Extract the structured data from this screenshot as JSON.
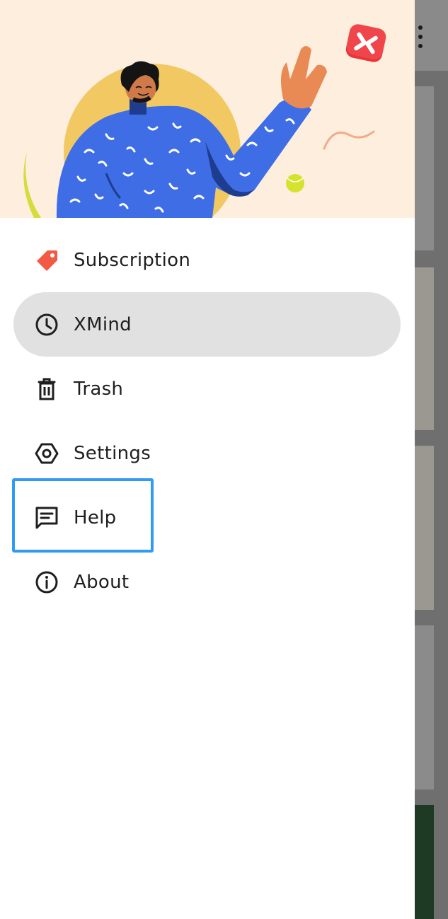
{
  "menu": {
    "items": [
      {
        "id": "subscription",
        "label": "Subscription",
        "icon": "tag-icon",
        "selected": false
      },
      {
        "id": "xmind",
        "label": "XMind",
        "icon": "clock-icon",
        "selected": true
      },
      {
        "id": "trash",
        "label": "Trash",
        "icon": "trash-icon",
        "selected": false
      },
      {
        "id": "settings",
        "label": "Settings",
        "icon": "settings-hex-icon",
        "selected": false
      },
      {
        "id": "help",
        "label": "Help",
        "icon": "chat-message-icon",
        "selected": false
      },
      {
        "id": "about",
        "label": "About",
        "icon": "info-icon",
        "selected": false
      }
    ]
  },
  "colors": {
    "accent_highlight": "#2f9bf2",
    "selected_bg": "#e1e1e1",
    "header_bg": "#fdeedd",
    "tag_red": "#f25a45",
    "figure_blue": "#3f6de6"
  }
}
